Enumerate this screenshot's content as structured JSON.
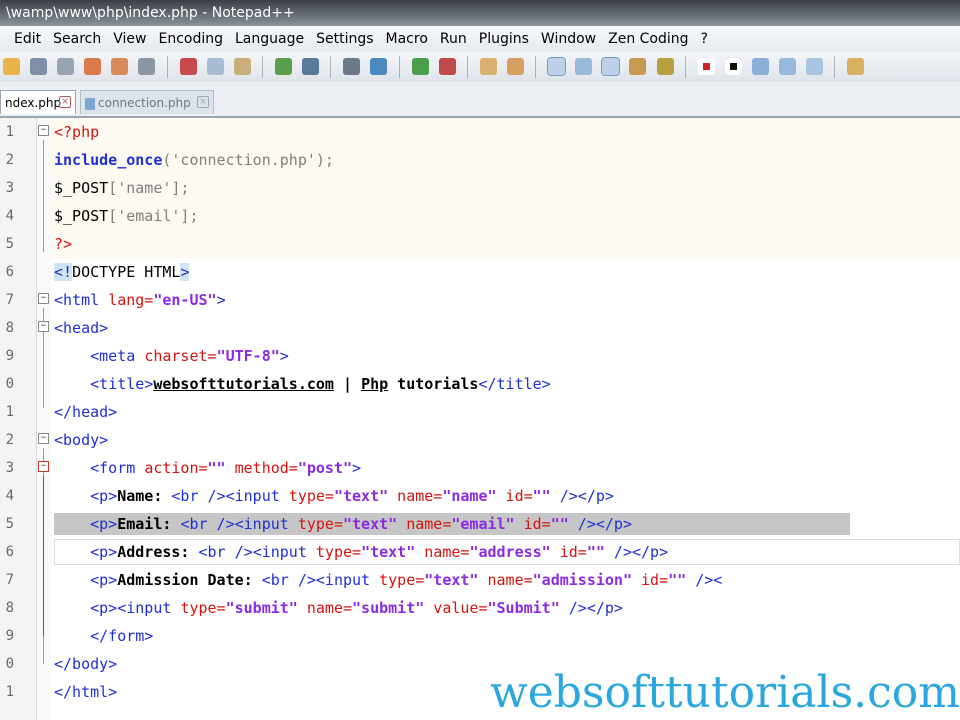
{
  "window": {
    "title": "\\wamp\\www\\php\\index.php - Notepad++"
  },
  "menu": [
    "Edit",
    "Search",
    "View",
    "Encoding",
    "Language",
    "Settings",
    "Macro",
    "Run",
    "Plugins",
    "Window",
    "Zen Coding",
    "?"
  ],
  "toolbar_icons": [
    "open-icon",
    "save-icon",
    "save-all-icon",
    "close-icon",
    "close-all-icon",
    "print-icon",
    "cut-icon",
    "copy-icon",
    "paste-icon",
    "undo-icon",
    "redo-icon",
    "find-icon",
    "replace-icon",
    "zoom-in-icon",
    "zoom-out-icon",
    "sync-v-icon",
    "sync-h-icon",
    "wrap-icon",
    "all-chars-icon",
    "indent-guide-icon",
    "udl-icon",
    "doc-map-icon",
    "record-macro-icon",
    "stop-record-icon",
    "play-macro-icon",
    "run-macro-icon",
    "save-macro-icon",
    "trim-icon"
  ],
  "tabs": [
    {
      "label": "ndex.php",
      "active": true
    },
    {
      "label": "connection.php",
      "active": false
    }
  ],
  "line_numbers": [
    "1",
    "2",
    "3",
    "4",
    "5",
    "6",
    "7",
    "8",
    "9",
    "0",
    "1",
    "2",
    "3",
    "4",
    "5",
    "6",
    "7",
    "8",
    "9",
    "0",
    "1"
  ],
  "code": {
    "l1_php_open": "<?php",
    "l2_kw": "include_once",
    "l2_arg": "('connection.php');",
    "l3_var": "$_POST",
    "l3_key": "['name'];",
    "l4_var": "$_POST",
    "l4_key": "['email'];",
    "l5_php_close": "?>",
    "l6_doctype_open": "<!",
    "l6_doctype_mid": "DOCTYPE HTML",
    "l6_doctype_close": ">",
    "l7_open": "<html ",
    "l7_attr": "lang=",
    "l7_val": "\"en-US\"",
    "l7_close": ">",
    "l8": "<head>",
    "l9_open": "<meta ",
    "l9_attr": "charset=",
    "l9_val": "\"UTF-8\"",
    "l9_close": ">",
    "l10_open": "<title>",
    "l10_site": "websofttutorials.com",
    "l10_sep": " | ",
    "l10_php": "Php",
    "l10_rest": " tutorials",
    "l10_close": "</title>",
    "l11": "</head>",
    "l12": "<body>",
    "l13_open": "<form ",
    "l13_attr1": "action=",
    "l13_val1": "\"\"",
    "l13_attr2": " method=",
    "l13_val2": "\"post\"",
    "l13_close": ">",
    "l14_p": "<p>",
    "l14_label": "Name: ",
    "l14_br": "<br />",
    "l14_input": "<input ",
    "l14_a1": "type=",
    "l14_v1": "\"text\"",
    "l14_a2": " name=",
    "l14_v2": "\"name\"",
    "l14_a3": " id=",
    "l14_v3": "\"\"",
    "l14_end": " /></p>",
    "l15_p": "<p>",
    "l15_label": "Email: ",
    "l15_br": "<br />",
    "l15_input": "<input ",
    "l15_a1": "type=",
    "l15_v1": "\"text\"",
    "l15_a2": " name=",
    "l15_v2": "\"email\"",
    "l15_a3": " id=",
    "l15_v3": "\"\"",
    "l15_end": " /></p>",
    "l16_p": "<p>",
    "l16_label": "Address: ",
    "l16_br": "<br />",
    "l16_input": "<input ",
    "l16_a1": "type=",
    "l16_v1": "\"text\"",
    "l16_a2": " name=",
    "l16_v2": "\"address\"",
    "l16_a3": " id=",
    "l16_v3": "\"\"",
    "l16_end": " /></p>",
    "l17_p": "<p>",
    "l17_label": "Admission Date: ",
    "l17_br": "<br />",
    "l17_input": "<input ",
    "l17_a1": "type=",
    "l17_v1": "\"text\"",
    "l17_a2": " name=",
    "l17_v2": "\"admission\"",
    "l17_a3": " id=",
    "l17_v3": "\"\"",
    "l17_end": " /><",
    "l18_p": "<p>",
    "l18_input": "<input ",
    "l18_a1": "type=",
    "l18_v1": "\"submit\"",
    "l18_a2": " name=",
    "l18_v2": "\"submit\"",
    "l18_a3": " value=",
    "l18_v3": "\"Submit\"",
    "l18_end": " /></p>",
    "l19": "</form>",
    "l20": "</body>",
    "l21": "</html>"
  },
  "watermark": "websofttutorials.com",
  "colors": {
    "tag": "#1f2fd1",
    "attribute": "#d3140f",
    "string": "#8a2be2",
    "watermark": "#2aa7df",
    "selection": "#c6c6c6"
  }
}
